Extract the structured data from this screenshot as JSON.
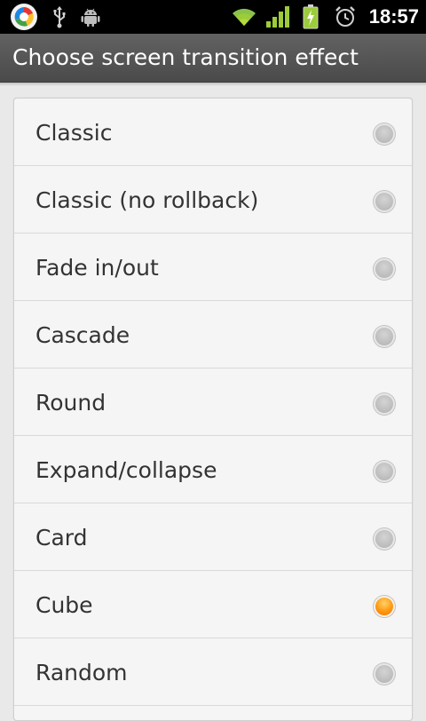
{
  "status_bar": {
    "time": "18:57",
    "icons": [
      "app-launcher-icon",
      "usb-icon",
      "android-debug-icon",
      "wifi-icon",
      "signal-icon",
      "battery-charging-icon",
      "alarm-clock-icon"
    ]
  },
  "dialog": {
    "title": "Choose screen transition effect"
  },
  "options": [
    {
      "label": "Classic",
      "selected": false
    },
    {
      "label": "Classic (no rollback)",
      "selected": false
    },
    {
      "label": "Fade in/out",
      "selected": false
    },
    {
      "label": "Cascade",
      "selected": false
    },
    {
      "label": "Round",
      "selected": false
    },
    {
      "label": "Expand/collapse",
      "selected": false
    },
    {
      "label": "Card",
      "selected": false
    },
    {
      "label": "Cube",
      "selected": true
    },
    {
      "label": "Random",
      "selected": false
    }
  ],
  "colors": {
    "radio_selected": "#ff9a12",
    "radio_unselected": "#bdbdbd",
    "title_bar": "#555555"
  }
}
